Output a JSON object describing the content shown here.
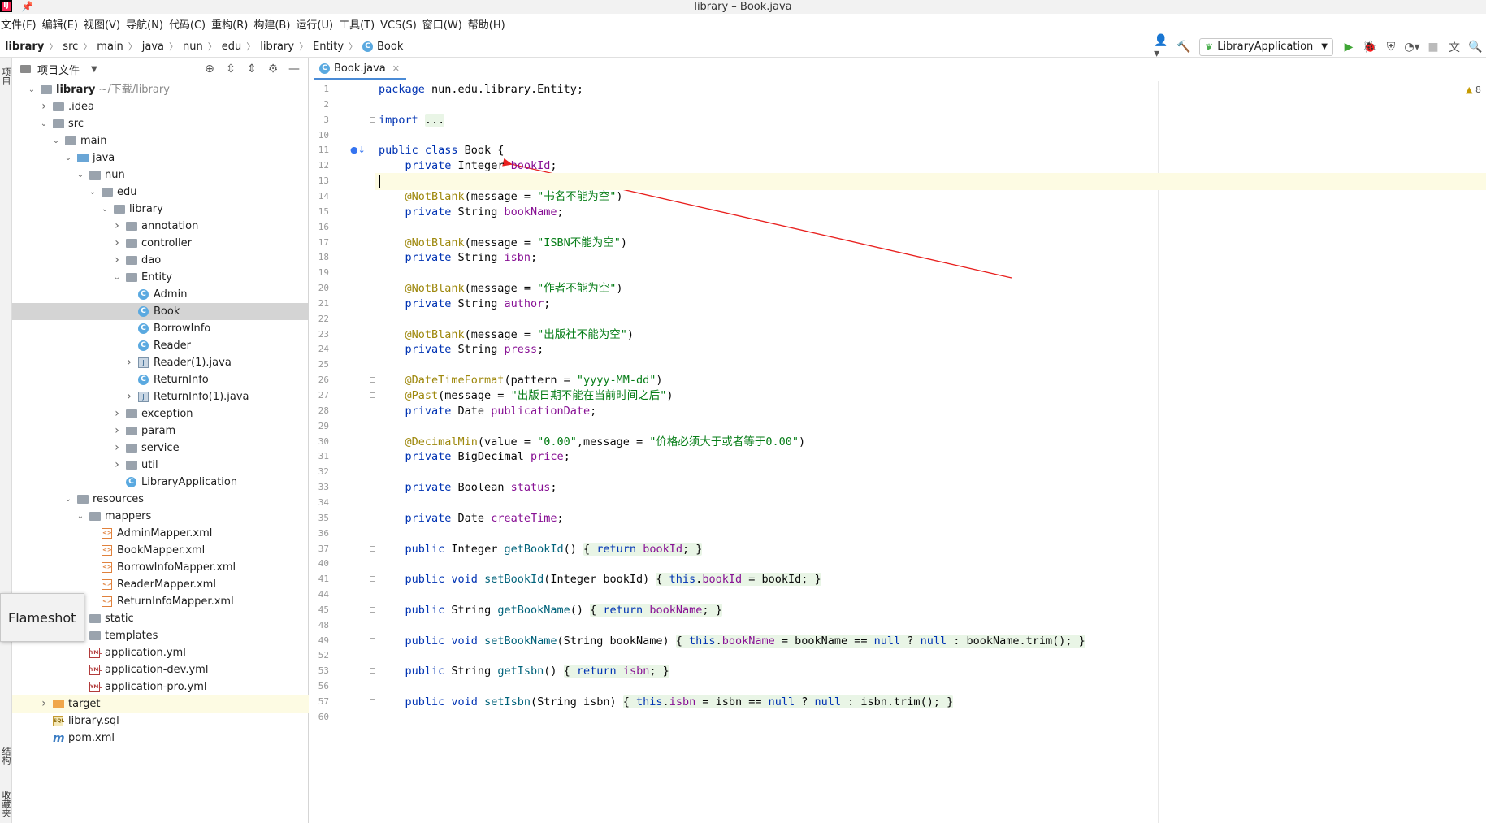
{
  "window": {
    "title": "library – Book.java",
    "app_icon": "intellij-icon",
    "pin_icon": "pin-icon"
  },
  "menu": [
    "文件(F)",
    "编辑(E)",
    "视图(V)",
    "导航(N)",
    "代码(C)",
    "重构(R)",
    "构建(B)",
    "运行(U)",
    "工具(T)",
    "VCS(S)",
    "窗口(W)",
    "帮助(H)"
  ],
  "breadcrumb": [
    "library",
    "src",
    "main",
    "java",
    "nun",
    "edu",
    "library",
    "Entity",
    "Book"
  ],
  "toolbar": {
    "run_config": "LibraryApplication"
  },
  "side_tabs": {
    "project": "项目",
    "structure": "结构",
    "favorites": "收藏夹"
  },
  "project_panel": {
    "title": "项目文件",
    "root_label": "library",
    "root_hint": "~/下载/library"
  },
  "tree": [
    {
      "label": "library",
      "hint": " ~/下载/library",
      "depth": 0,
      "arrow": "down",
      "icon": "module",
      "bold": true
    },
    {
      "label": ".idea",
      "depth": 1,
      "arrow": "right",
      "icon": "folder"
    },
    {
      "label": "src",
      "depth": 1,
      "arrow": "down",
      "icon": "folder"
    },
    {
      "label": "main",
      "depth": 2,
      "arrow": "down",
      "icon": "folder"
    },
    {
      "label": "java",
      "depth": 3,
      "arrow": "down",
      "icon": "folder-blue"
    },
    {
      "label": "nun",
      "depth": 4,
      "arrow": "down",
      "icon": "package"
    },
    {
      "label": "edu",
      "depth": 5,
      "arrow": "down",
      "icon": "package"
    },
    {
      "label": "library",
      "depth": 6,
      "arrow": "down",
      "icon": "package"
    },
    {
      "label": "annotation",
      "depth": 7,
      "arrow": "right",
      "icon": "package"
    },
    {
      "label": "controller",
      "depth": 7,
      "arrow": "right",
      "icon": "package"
    },
    {
      "label": "dao",
      "depth": 7,
      "arrow": "right",
      "icon": "package"
    },
    {
      "label": "Entity",
      "depth": 7,
      "arrow": "down",
      "icon": "package"
    },
    {
      "label": "Admin",
      "depth": 8,
      "arrow": "",
      "icon": "class"
    },
    {
      "label": "Book",
      "depth": 8,
      "arrow": "",
      "icon": "class",
      "selected": true
    },
    {
      "label": "BorrowInfo",
      "depth": 8,
      "arrow": "",
      "icon": "class"
    },
    {
      "label": "Reader",
      "depth": 8,
      "arrow": "",
      "icon": "class"
    },
    {
      "label": "Reader(1).java",
      "depth": 8,
      "arrow": "right",
      "icon": "java"
    },
    {
      "label": "ReturnInfo",
      "depth": 8,
      "arrow": "",
      "icon": "class"
    },
    {
      "label": "ReturnInfo(1).java",
      "depth": 8,
      "arrow": "right",
      "icon": "java"
    },
    {
      "label": "exception",
      "depth": 7,
      "arrow": "right",
      "icon": "package"
    },
    {
      "label": "param",
      "depth": 7,
      "arrow": "right",
      "icon": "package"
    },
    {
      "label": "service",
      "depth": 7,
      "arrow": "right",
      "icon": "package"
    },
    {
      "label": "util",
      "depth": 7,
      "arrow": "right",
      "icon": "package"
    },
    {
      "label": "LibraryApplication",
      "depth": 7,
      "arrow": "",
      "icon": "class"
    },
    {
      "label": "resources",
      "depth": 3,
      "arrow": "down",
      "icon": "folder-res"
    },
    {
      "label": "mappers",
      "depth": 4,
      "arrow": "down",
      "icon": "folder"
    },
    {
      "label": "AdminMapper.xml",
      "depth": 5,
      "arrow": "",
      "icon": "xml"
    },
    {
      "label": "BookMapper.xml",
      "depth": 5,
      "arrow": "",
      "icon": "xml"
    },
    {
      "label": "BorrowInfoMapper.xml",
      "depth": 5,
      "arrow": "",
      "icon": "xml"
    },
    {
      "label": "ReaderMapper.xml",
      "depth": 5,
      "arrow": "",
      "icon": "xml"
    },
    {
      "label": "ReturnInfoMapper.xml",
      "depth": 5,
      "arrow": "",
      "icon": "xml"
    },
    {
      "label": "static",
      "depth": 4,
      "arrow": "",
      "icon": "folder"
    },
    {
      "label": "templates",
      "depth": 4,
      "arrow": "",
      "icon": "folder"
    },
    {
      "label": "application.yml",
      "depth": 4,
      "arrow": "",
      "icon": "yml"
    },
    {
      "label": "application-dev.yml",
      "depth": 4,
      "arrow": "",
      "icon": "yml"
    },
    {
      "label": "application-pro.yml",
      "depth": 4,
      "arrow": "",
      "icon": "yml"
    },
    {
      "label": "target",
      "depth": 1,
      "arrow": "right",
      "icon": "folder-orange",
      "highlight": true
    },
    {
      "label": "library.sql",
      "depth": 1,
      "arrow": "",
      "icon": "sql"
    },
    {
      "label": "pom.xml",
      "depth": 1,
      "arrow": "",
      "icon": "maven"
    }
  ],
  "flameshot_label": "Flameshot",
  "editor": {
    "tab_label": "Book.java",
    "warning_count": "8",
    "lines": [
      {
        "n": "1",
        "html": "<span class='kw'>package</span> nun.edu.library.Entity;"
      },
      {
        "n": "2",
        "html": ""
      },
      {
        "n": "3",
        "html": "<span class='kw'>import</span> <span class='fold-b'>...</span>",
        "fold": true
      },
      {
        "n": "10",
        "html": ""
      },
      {
        "n": "11",
        "html": "<span class='kw'>public class</span> Book {",
        "gutter_icon": true
      },
      {
        "n": "12",
        "html": "    <span class='kw'>private</span> Integer <span class='fld'>bookId</span>;"
      },
      {
        "n": "13",
        "html": "<span class='caret-bar'></span>",
        "current": true
      },
      {
        "n": "14",
        "html": "    <span class='ann'>@NotBlank</span>(message = <span class='str'>\"书名不能为空\"</span>)"
      },
      {
        "n": "15",
        "html": "    <span class='kw'>private</span> String <span class='fld'>bookName</span>;"
      },
      {
        "n": "16",
        "html": ""
      },
      {
        "n": "17",
        "html": "    <span class='ann'>@NotBlank</span>(message = <span class='str'>\"ISBN不能为空\"</span>)"
      },
      {
        "n": "18",
        "html": "    <span class='kw'>private</span> String <span class='fld'>isbn</span>;"
      },
      {
        "n": "19",
        "html": ""
      },
      {
        "n": "20",
        "html": "    <span class='ann'>@NotBlank</span>(message = <span class='str'>\"作者不能为空\"</span>)"
      },
      {
        "n": "21",
        "html": "    <span class='kw'>private</span> String <span class='fld'>author</span>;"
      },
      {
        "n": "22",
        "html": ""
      },
      {
        "n": "23",
        "html": "    <span class='ann'>@NotBlank</span>(message = <span class='str'>\"出版社不能为空\"</span>)"
      },
      {
        "n": "24",
        "html": "    <span class='kw'>private</span> String <span class='fld'>press</span>;"
      },
      {
        "n": "25",
        "html": ""
      },
      {
        "n": "26",
        "html": "    <span class='ann'>@DateTimeFormat</span>(pattern = <span class='str'>\"yyyy-MM-dd\"</span>)",
        "fold": true
      },
      {
        "n": "27",
        "html": "    <span class='ann'>@Past</span>(message = <span class='str'>\"出版日期不能在当前时间之后\"</span>)",
        "fold": true
      },
      {
        "n": "28",
        "html": "    <span class='kw'>private</span> Date <span class='fld'>publicationDate</span>;"
      },
      {
        "n": "29",
        "html": ""
      },
      {
        "n": "30",
        "html": "    <span class='ann'>@DecimalMin</span>(value = <span class='str'>\"0.00\"</span>,message = <span class='str'>\"价格必须大于或者等于0.00\"</span>)"
      },
      {
        "n": "31",
        "html": "    <span class='kw'>private</span> BigDecimal <span class='fld'>price</span>;"
      },
      {
        "n": "32",
        "html": ""
      },
      {
        "n": "33",
        "html": "    <span class='kw'>private</span> Boolean <span class='fld'>status</span>;"
      },
      {
        "n": "34",
        "html": ""
      },
      {
        "n": "35",
        "html": "    <span class='kw'>private</span> Date <span class='fld'>createTime</span>;"
      },
      {
        "n": "36",
        "html": ""
      },
      {
        "n": "37",
        "html": "    <span class='kw'>public</span> Integer <span class='mth'>getBookId</span>() <span class='fold-b'>{ <span class='kw'>return</span> <span class='fld'>bookId</span>; }</span>",
        "fold": true
      },
      {
        "n": "40",
        "html": ""
      },
      {
        "n": "41",
        "html": "    <span class='kw'>public void</span> <span class='mth'>setBookId</span>(Integer bookId) <span class='fold-b'>{ <span class='kw'>this</span>.<span class='fld'>bookId</span> = bookId; }</span>",
        "fold": true
      },
      {
        "n": "44",
        "html": ""
      },
      {
        "n": "45",
        "html": "    <span class='kw'>public</span> String <span class='mth'>getBookName</span>() <span class='fold-b'>{ <span class='kw'>return</span> <span class='fld'>bookName</span>; }</span>",
        "fold": true
      },
      {
        "n": "48",
        "html": ""
      },
      {
        "n": "49",
        "html": "    <span class='kw'>public void</span> <span class='mth'>setBookName</span>(String bookName) <span class='fold-b'>{ <span class='kw'>this</span>.<span class='fld'>bookName</span> = bookName == <span class='kw'>null</span> ? <span class='kw'>null</span> : bookName.trim(); }</span>",
        "fold": true
      },
      {
        "n": "52",
        "html": ""
      },
      {
        "n": "53",
        "html": "    <span class='kw'>public</span> String <span class='mth'>getIsbn</span>() <span class='fold-b'>{ <span class='kw'>return</span> <span class='fld'>isbn</span>; }</span>",
        "fold": true
      },
      {
        "n": "56",
        "html": ""
      },
      {
        "n": "57",
        "html": "    <span class='kw'>public void</span> <span class='mth'>setIsbn</span>(String isbn) <span class='fold-b'>{ <span class='kw'>this</span>.<span class='fld'>isbn</span> = isbn == <span class='kw'>null</span> ? <span class='kw'>null</span> : isbn.trim(); }</span>",
        "fold": true
      },
      {
        "n": "60",
        "html": ""
      }
    ]
  },
  "colors": {
    "annotation_arrow": "#e8201e",
    "selection": "#d4d4d4",
    "accent": "#4a8bd6"
  }
}
